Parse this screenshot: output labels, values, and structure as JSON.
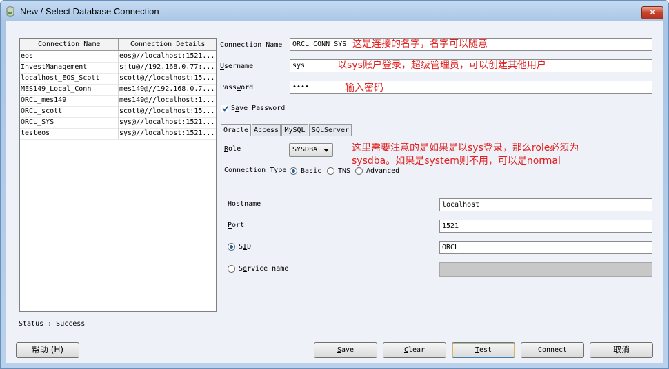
{
  "window": {
    "title": "New / Select Database Connection",
    "close_label": "✕"
  },
  "connections": {
    "headers": [
      "Connection Name",
      "Connection Details"
    ],
    "rows": [
      {
        "name": "eos",
        "details": "eos@//localhost:1521..."
      },
      {
        "name": "InvestManagement",
        "details": "sjtu@//192.168.0.77:..."
      },
      {
        "name": "localhost_EOS_Scott",
        "details": "scott@//localhost:15..."
      },
      {
        "name": "MES149_Local_Conn",
        "details": "mes149@//192.168.0.7..."
      },
      {
        "name": "ORCL_mes149",
        "details": "mes149@//localhost:1..."
      },
      {
        "name": "ORCL_scott",
        "details": "scott@//localhost:15..."
      },
      {
        "name": "ORCL_SYS",
        "details": "sys@//localhost:1521..."
      },
      {
        "name": "testeos",
        "details": "sys@//localhost:1521..."
      }
    ]
  },
  "status": {
    "text": "Status : Success"
  },
  "form": {
    "connection_name": {
      "label": "Connection Name",
      "value": "ORCL_CONN_SYS",
      "note": "这是连接的名字，名字可以随意"
    },
    "username": {
      "label": "Username",
      "value": "sys",
      "note": "以sys账户登录，超级管理员，可以创建其他用户"
    },
    "password": {
      "label": "Password",
      "value": "••••",
      "note": "输入密码"
    },
    "save_password": {
      "label": "Save Password",
      "checked": true
    }
  },
  "tabs": [
    "Oracle",
    "Access",
    "MySQL",
    "SQLServer"
  ],
  "oracle": {
    "role_label": "Role",
    "role_value": "SYSDBA",
    "role_note_line1": "这里需要注意的是如果是以sys登录，那么role必须为",
    "role_note_line2": "sysdba。如果是system则不用，可以是normal",
    "conn_type_label": "Connection Type",
    "conn_types": [
      "Basic",
      "TNS",
      "Advanced"
    ],
    "conn_type_selected": "Basic",
    "hostname_label": "Hostname",
    "hostname_value": "localhost",
    "port_label": "Port",
    "port_value": "1521",
    "sid_label": "SID",
    "sid_value": "ORCL",
    "service_label": "Service name",
    "service_value": ""
  },
  "buttons": {
    "help": "帮助 (H)",
    "save": "Save",
    "clear": "Clear",
    "test": "Test",
    "connect": "Connect",
    "cancel": "取消"
  },
  "icons": {
    "title_icon": "database-icon",
    "close": "close-icon",
    "check": "checkmark-icon",
    "dropdown": "chevron-down-icon"
  }
}
